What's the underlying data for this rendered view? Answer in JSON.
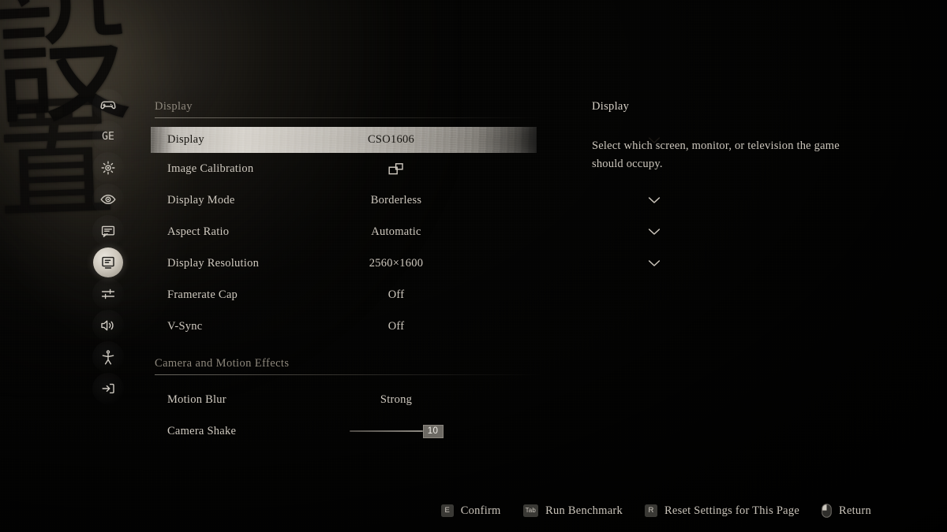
{
  "background": {
    "kanji_top": "設",
    "kanji_bottom": "置"
  },
  "sidebar": {
    "items": [
      {
        "name": "gamepad",
        "icon": "gamepad-icon",
        "active": false
      },
      {
        "name": "language",
        "icon": "language-ge-icon",
        "glyph": "GE",
        "active": false
      },
      {
        "name": "gameplay",
        "icon": "gear-icon",
        "active": false
      },
      {
        "name": "vision",
        "icon": "eye-icon",
        "active": false
      },
      {
        "name": "subtitles",
        "icon": "speech-bubble-icon",
        "active": false
      },
      {
        "name": "display",
        "icon": "monitor-icon",
        "active": true
      },
      {
        "name": "graphics",
        "icon": "sliders-icon",
        "active": false
      },
      {
        "name": "audio",
        "icon": "speaker-icon",
        "active": false
      },
      {
        "name": "accessibility",
        "icon": "accessibility-icon",
        "active": false
      },
      {
        "name": "quit",
        "icon": "exit-icon",
        "active": false
      }
    ]
  },
  "settings": {
    "sections": [
      {
        "header": "Display",
        "rows": [
          {
            "label": "Display",
            "value": "CSO1606",
            "control": "dropdown",
            "selected": true
          },
          {
            "label": "Image Calibration",
            "value": "",
            "control": "icon"
          },
          {
            "label": "Display Mode",
            "value": "Borderless",
            "control": "dropdown"
          },
          {
            "label": "Aspect Ratio",
            "value": "Automatic",
            "control": "dropdown"
          },
          {
            "label": "Display Resolution",
            "value": "2560×1600",
            "control": "dropdown"
          },
          {
            "label": "Framerate Cap",
            "value": "Off",
            "control": "text"
          },
          {
            "label": "V-Sync",
            "value": "Off",
            "control": "text"
          }
        ]
      },
      {
        "header": "Camera and Motion Effects",
        "rows": [
          {
            "label": "Motion Blur",
            "value": "Strong",
            "control": "text"
          },
          {
            "label": "Camera Shake",
            "value": "10",
            "control": "slider",
            "slider_percent": 100
          }
        ]
      }
    ]
  },
  "description": {
    "title": "Display",
    "body": "Select which screen, monitor, or television the game should occupy."
  },
  "hints": [
    {
      "key": "E",
      "key_type": "letter",
      "label": "Confirm"
    },
    {
      "key": "Tab",
      "key_type": "tab",
      "label": "Run Benchmark"
    },
    {
      "key": "R",
      "key_type": "letter",
      "label": "Reset Settings for This Page"
    },
    {
      "key": "",
      "key_type": "mouse",
      "label": "Return"
    }
  ],
  "colors": {
    "background": "#050504",
    "text_primary": "#cfc9bf",
    "text_muted": "#8d877c",
    "selected_row": "#d8d4cd",
    "selected_text": "#15130f"
  }
}
